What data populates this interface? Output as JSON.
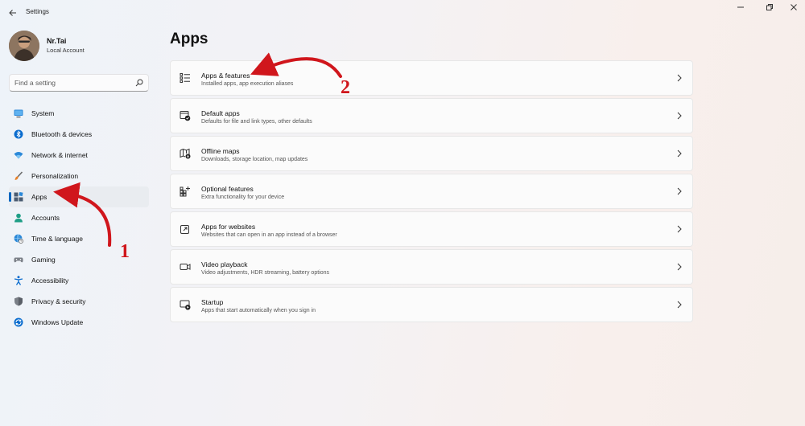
{
  "window": {
    "title": "Settings"
  },
  "profile": {
    "name": "Nr.Tai",
    "account_type": "Local Account"
  },
  "search": {
    "placeholder": "Find a setting"
  },
  "sidebar": {
    "items": [
      {
        "label": "System",
        "icon": "monitor-icon",
        "active": false
      },
      {
        "label": "Bluetooth & devices",
        "icon": "bluetooth-icon",
        "active": false
      },
      {
        "label": "Network & internet",
        "icon": "wifi-icon",
        "active": false
      },
      {
        "label": "Personalization",
        "icon": "brush-icon",
        "active": false
      },
      {
        "label": "Apps",
        "icon": "apps-icon",
        "active": true
      },
      {
        "label": "Accounts",
        "icon": "person-icon",
        "active": false
      },
      {
        "label": "Time & language",
        "icon": "globe-clock-icon",
        "active": false
      },
      {
        "label": "Gaming",
        "icon": "gamepad-icon",
        "active": false
      },
      {
        "label": "Accessibility",
        "icon": "accessibility-icon",
        "active": false
      },
      {
        "label": "Privacy & security",
        "icon": "shield-icon",
        "active": false
      },
      {
        "label": "Windows Update",
        "icon": "update-icon",
        "active": false
      }
    ]
  },
  "main": {
    "title": "Apps",
    "cards": [
      {
        "title": "Apps & features",
        "subtitle": "Installed apps, app execution aliases",
        "icon": "list-icon"
      },
      {
        "title": "Default apps",
        "subtitle": "Defaults for file and link types, other defaults",
        "icon": "default-apps-icon"
      },
      {
        "title": "Offline maps",
        "subtitle": "Downloads, storage location, map updates",
        "icon": "map-icon"
      },
      {
        "title": "Optional features",
        "subtitle": "Extra functionality for your device",
        "icon": "add-grid-icon"
      },
      {
        "title": "Apps for websites",
        "subtitle": "Websites that can open in an app instead of a browser",
        "icon": "link-window-icon"
      },
      {
        "title": "Video playback",
        "subtitle": "Video adjustments, HDR streaming, battery options",
        "icon": "video-icon"
      },
      {
        "title": "Startup",
        "subtitle": "Apps that start automatically when you sign in",
        "icon": "startup-icon"
      }
    ]
  },
  "annotations": {
    "step1": "1",
    "step2": "2",
    "color": "#d0161c"
  },
  "colors": {
    "accent": "#0067c0"
  }
}
